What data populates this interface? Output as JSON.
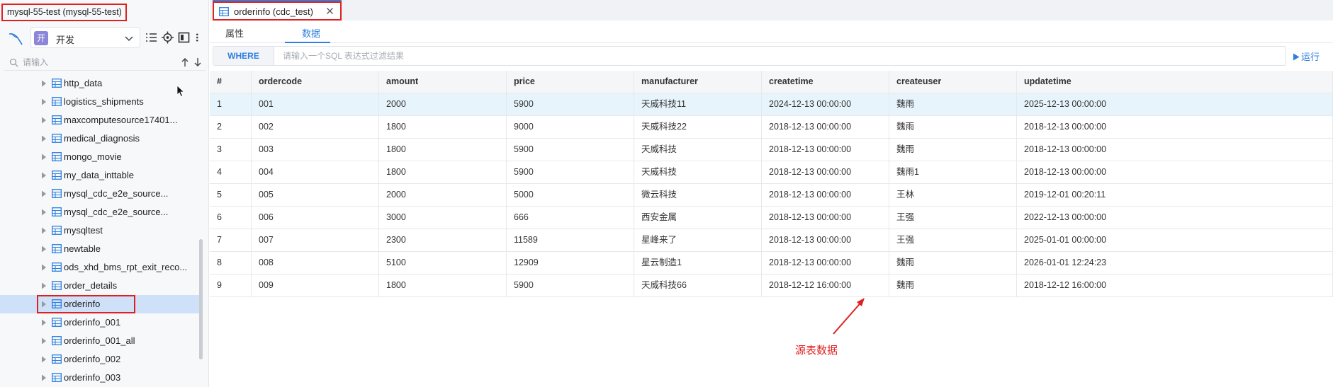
{
  "sidebar": {
    "connection_title": "mysql-55-test  (mysql-55-test)",
    "env": {
      "badge": "开",
      "label": "开发"
    },
    "search_placeholder": "请输入",
    "tree": [
      {
        "name": "http_data"
      },
      {
        "name": "logistics_shipments"
      },
      {
        "name": "maxcomputesource17401..."
      },
      {
        "name": "medical_diagnosis"
      },
      {
        "name": "mongo_movie"
      },
      {
        "name": "my_data_inttable"
      },
      {
        "name": "mysql_cdc_e2e_source..."
      },
      {
        "name": "mysql_cdc_e2e_source..."
      },
      {
        "name": "mysqltest"
      },
      {
        "name": "newtable"
      },
      {
        "name": "ods_xhd_bms_rpt_exit_reco..."
      },
      {
        "name": "order_details"
      },
      {
        "name": "orderinfo",
        "selected": true
      },
      {
        "name": "orderinfo_001"
      },
      {
        "name": "orderinfo_001_all"
      },
      {
        "name": "orderinfo_002"
      },
      {
        "name": "orderinfo_003"
      }
    ]
  },
  "main": {
    "tab": {
      "label": "orderinfo (cdc_test)"
    },
    "subtabs": [
      "属性",
      "数据"
    ],
    "active_subtab": 1,
    "filter": {
      "where_label": "WHERE",
      "placeholder": "请输入一个SQL 表达式过滤结果",
      "run_label": "运行"
    },
    "table": {
      "columns": [
        "#",
        "ordercode",
        "amount",
        "price",
        "manufacturer",
        "createtime",
        "createuser",
        "updatetime"
      ],
      "rows": [
        [
          "1",
          "001",
          "2000",
          "5900",
          "天威科技11",
          "2024-12-13 00:00:00",
          "魏雨",
          "2025-12-13 00:00:00"
        ],
        [
          "2",
          "002",
          "1800",
          "9000",
          "天威科技22",
          "2018-12-13 00:00:00",
          "魏雨",
          "2018-12-13 00:00:00"
        ],
        [
          "3",
          "003",
          "1800",
          "5900",
          "天威科技",
          "2018-12-13 00:00:00",
          "魏雨",
          "2018-12-13 00:00:00"
        ],
        [
          "4",
          "004",
          "1800",
          "5900",
          "天威科技",
          "2018-12-13 00:00:00",
          "魏雨1",
          "2018-12-13 00:00:00"
        ],
        [
          "5",
          "005",
          "2000",
          "5000",
          "微云科技",
          "2018-12-13 00:00:00",
          "王林",
          "2019-12-01 00:20:11"
        ],
        [
          "6",
          "006",
          "3000",
          "666",
          "西安金属",
          "2018-12-13 00:00:00",
          "王强",
          "2022-12-13 00:00:00"
        ],
        [
          "7",
          "007",
          "2300",
          "11589",
          "星峰来了",
          "2018-12-13 00:00:00",
          "王强",
          "2025-01-01 00:00:00"
        ],
        [
          "8",
          "008",
          "5100",
          "12909",
          "星云制造1",
          "2018-12-13 00:00:00",
          "魏雨",
          "2026-01-01 12:24:23"
        ],
        [
          "9",
          "009",
          "1800",
          "5900",
          "天威科技66",
          "2018-12-12 16:00:00",
          "魏雨",
          "2018-12-12 16:00:00"
        ]
      ],
      "highlighted_row": 0
    },
    "annotation": "源表数据"
  },
  "colors": {
    "accent": "#2d7fe0",
    "annotation_red": "#e02020",
    "selected_bg": "#cfe1f8",
    "row_highlight": "#e7f4fb"
  }
}
